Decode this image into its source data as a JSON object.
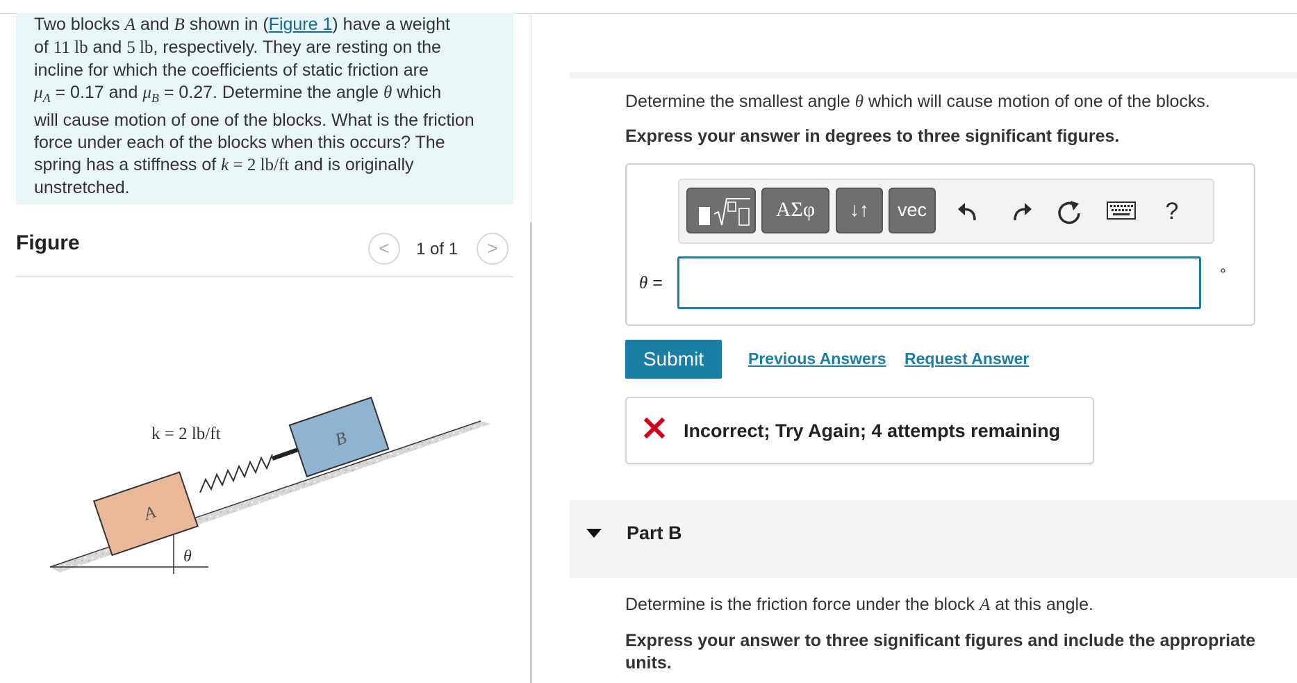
{
  "problem": {
    "line1_pre": "Two blocks ",
    "blockA": "A",
    "and": " and ",
    "blockB": "B",
    "shown_in": " shown in (",
    "figure_link": "Figure 1",
    "close_paren": ") have a weight",
    "line2_pre": "of ",
    "w_a": "11 lb",
    "and2": " and ",
    "w_b": "5 lb",
    "line2_post": ", respectively. They are resting on the",
    "line3": "incline for which the coefficients of static friction are",
    "mu": "μ",
    "sub_a": "A",
    "mu_a_val": " = 0.17 and ",
    "sub_b": "B",
    "mu_b_val": " = 0.27. Determine the angle ",
    "theta": "θ",
    "line4_post": " which",
    "line5": "will cause motion of one of the blocks. What is the friction",
    "line6": "force under each of the blocks when this occurs? The",
    "line7_pre": "spring has a stiffness of ",
    "k": "k",
    "k_val": " = 2 lb/ft",
    "line7_post": " and is originally",
    "line8": "unstretched."
  },
  "figure": {
    "title": "Figure",
    "pager_prev": "<",
    "pager_next": ">",
    "pager_text": "1 of 1",
    "spring_label": "k = 2 lb/ft",
    "label_a": "A",
    "label_b": "B",
    "angle_label": "θ",
    "colors": {
      "block_a": "#e8b898",
      "block_b": "#8fb3d1"
    }
  },
  "part_a": {
    "question_pre": "Determine the smallest angle ",
    "theta": "θ",
    "question_post": " which will cause motion of one of the blocks.",
    "instruction": "Express your answer in degrees to three significant figures.",
    "toolbar": {
      "templates_icon": "templates-icon",
      "greek_label": "ΑΣφ",
      "arrows_label": "↓↑",
      "vec_label": "vec",
      "help_label": "?"
    },
    "answer_label": "θ =",
    "answer_value": "",
    "unit": "°",
    "submit": "Submit",
    "previous_answers": "Previous Answers",
    "request_answer": "Request Answer",
    "feedback": "Incorrect; Try Again; 4 attempts remaining",
    "colors": {
      "accent": "#1b7ea6",
      "error": "#d0021b"
    }
  },
  "part_b": {
    "title": "Part B",
    "question_pre": "Determine is the friction force under the block ",
    "block": "A",
    "question_post": " at this angle.",
    "instruction": "Express your answer to three significant figures and include the appropriate units."
  }
}
